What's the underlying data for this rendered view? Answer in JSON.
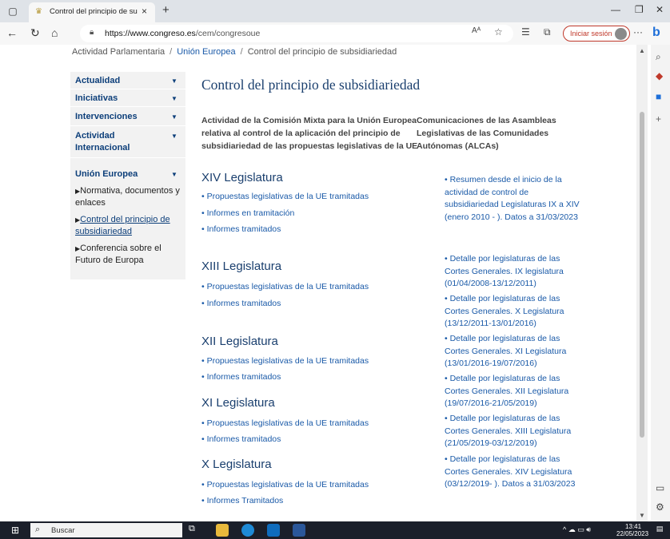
{
  "browser": {
    "tab_title": "Control del principio de subsidia",
    "tab_close": "×",
    "new_tab": "+",
    "url_domain": "https://www.congreso.es",
    "url_path": "/cem/congresoue",
    "read_aloud": "Aᴬ",
    "sign_in": "Iniciar sesión",
    "menu": "···"
  },
  "breadcrumb": {
    "root": "Actividad Parlamentaria",
    "separator": "/",
    "parent": "Unión Europea",
    "current": "Control del principio de subsidiariedad"
  },
  "nav": {
    "items": [
      {
        "label": "Actualidad"
      },
      {
        "label": "Iniciativas"
      },
      {
        "label": "Intervenciones"
      },
      {
        "label": "Actividad Internacional"
      },
      {
        "label": "Unión Europea"
      }
    ],
    "subitems": [
      {
        "label": "Normativa, documentos y enlaces"
      },
      {
        "label": "Control del principio de subsidiariedad"
      },
      {
        "label": "Conferencia sobre el Futuro de Europa"
      }
    ]
  },
  "page": {
    "title": "Control del principio de subsidiariedad",
    "col1_intro": "Actividad de la Comisión Mixta para la Unión Europea relativa al control de la aplicación del principio de subsidiariedad de las propuestas legislativas de la UE",
    "col2_intro": "Comunicaciones de las Asambleas Legislativas de las Comunidades Autónomas (ALCAs)"
  },
  "legislaturas": [
    {
      "title": "XIV Legislatura",
      "links": [
        "• Propuestas legislativas de la UE tramitadas",
        "• Informes en tramitación",
        "• Informes tramitados"
      ]
    },
    {
      "title": "XIII Legislatura",
      "links": [
        "• Propuestas legislativas de la UE tramitadas",
        "• Informes tramitados"
      ]
    },
    {
      "title": "XII Legislatura",
      "links": [
        "• Propuestas legislativas de la UE tramitadas",
        "• Informes tramitados"
      ]
    },
    {
      "title": "XI Legislatura",
      "links": [
        "• Propuestas legislativas de la UE tramitadas",
        "• Informes tramitados"
      ]
    },
    {
      "title": "X Legislatura",
      "links": [
        "• Propuestas legislativas de la UE tramitadas",
        "• Informes Tramitados"
      ]
    }
  ],
  "alcas": [
    "• Resumen desde el inicio de la actividad de control de subsidiariedad Legislaturas IX a XIV (enero 2010 - ). Datos a 31/03/2023",
    "• Detalle por legislaturas de las Cortes Generales. IX legislatura (01/04/2008-13/12/2011)",
    "• Detalle por legislaturas de las Cortes Generales. X Legislatura (13/12/2011-13/01/2016)",
    "• Detalle por legislaturas de las Cortes Generales. XI Legislatura (13/01/2016-19/07/2016)",
    "• Detalle por legislaturas de las Cortes Generales. XII Legislatura (19/07/2016-21/05/2019)",
    "• Detalle por legislaturas de las Cortes Generales. XIII Legislatura (21/05/2019-03/12/2019)",
    "• Detalle por legislaturas de las Cortes Generales. XIV Legislatura (03/12/2019- ). Datos a 31/03/2023"
  ],
  "taskbar": {
    "search_label": "Buscar",
    "time": "13:41",
    "date": "22/05/2023"
  }
}
